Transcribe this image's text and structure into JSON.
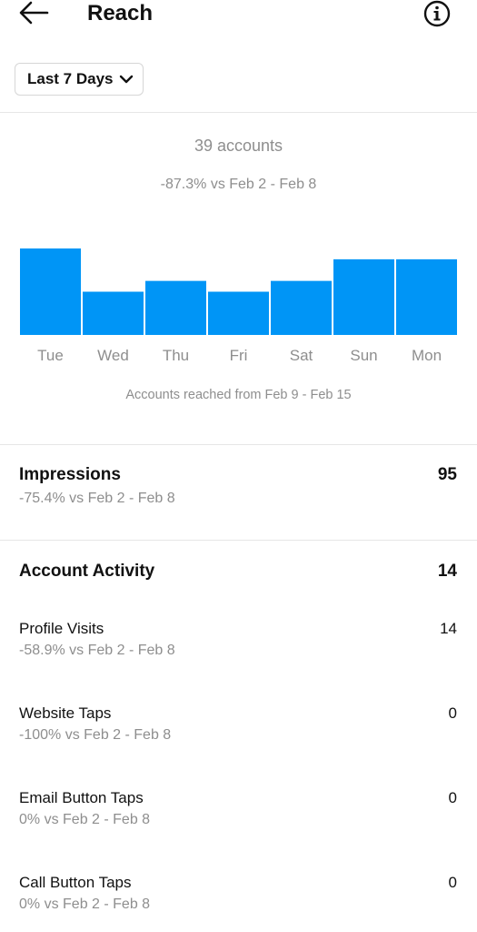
{
  "header": {
    "title": "Reach",
    "back_icon": "arrow-left-icon",
    "info_icon": "info-circle-icon"
  },
  "date_range": {
    "label": "Last 7 Days",
    "icon": "chevron-down-icon"
  },
  "summary": {
    "value": "39 accounts",
    "compare": "-87.3% vs Feb 2 - Feb 8"
  },
  "chart_data": {
    "type": "bar",
    "categories": [
      "Tue",
      "Wed",
      "Thu",
      "Fri",
      "Sat",
      "Sun",
      "Mon"
    ],
    "values": [
      8,
      4,
      5,
      4,
      5,
      7,
      7
    ],
    "color": "#0095f6",
    "caption": "Accounts reached from Feb 9 - Feb 15"
  },
  "impressions": {
    "title": "Impressions",
    "value": "95",
    "compare": "-75.4% vs Feb 2 - Feb 8"
  },
  "account_activity": {
    "title": "Account Activity",
    "value": "14",
    "metrics": [
      {
        "label": "Profile Visits",
        "compare": "-58.9% vs Feb 2 - Feb 8",
        "value": "14"
      },
      {
        "label": "Website Taps",
        "compare": "-100% vs Feb 2 - Feb 8",
        "value": "0"
      },
      {
        "label": "Email Button Taps",
        "compare": "0% vs Feb 2 - Feb 8",
        "value": "0"
      },
      {
        "label": "Call Button Taps",
        "compare": "0% vs Feb 2 - Feb 8",
        "value": "0"
      }
    ]
  }
}
